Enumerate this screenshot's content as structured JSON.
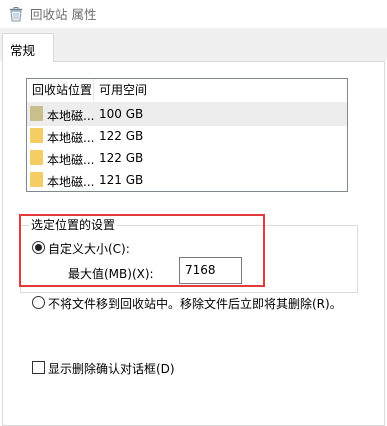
{
  "window": {
    "title": "回收站 属性"
  },
  "tabs": [
    {
      "label": "常规"
    }
  ],
  "locations_list": {
    "columns": [
      "回收站位置",
      "可用空间"
    ],
    "rows": [
      {
        "name": "本地磁...",
        "free": "100 GB",
        "selected": true
      },
      {
        "name": "本地磁...",
        "free": "122 GB"
      },
      {
        "name": "本地磁...",
        "free": "122 GB"
      },
      {
        "name": "本地磁...",
        "free": "121 GB"
      }
    ]
  },
  "settings_group": {
    "title": "选定位置的设置",
    "custom_size_label": "自定义大小(C):",
    "max_size_label": "最大值(MB)(X):",
    "max_size_value": "7168",
    "no_recycle_label": "不将文件移到回收站中。移除文件后立即将其删除(R)。"
  },
  "confirm_checkbox": {
    "label": "显示删除确认对话框(D)"
  },
  "colors": {
    "highlight_frame": "#e33b3b",
    "folder_selected": "#c8bf8c",
    "folder": "#f4cd65",
    "selected_row": "#ededed"
  },
  "icons": {
    "title": "recycle-bin-icon",
    "folder": "folder-icon"
  }
}
